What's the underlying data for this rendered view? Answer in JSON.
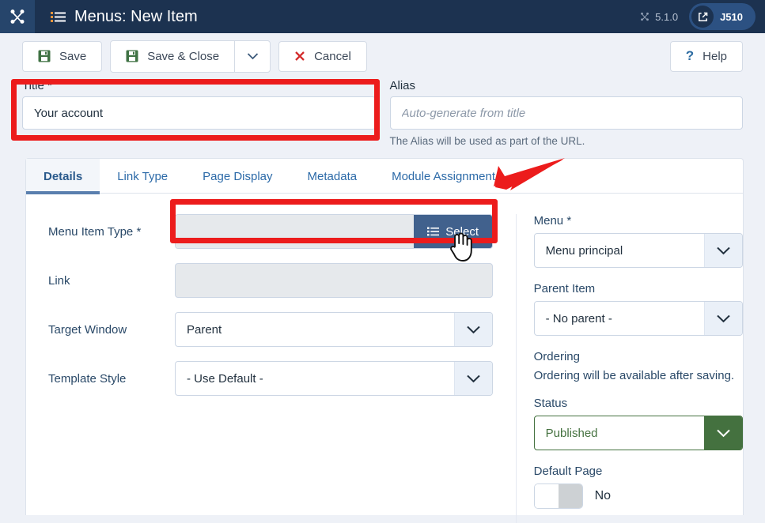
{
  "header": {
    "brand_icon": "joomla-logo-icon",
    "menu_icon": "list-icon",
    "title": "Menus: New Item",
    "version": "5.1.0",
    "version_icon": "joomla-mark-icon",
    "site_badge": "J510",
    "site_badge_icon": "external-link-icon"
  },
  "toolbar": {
    "save_label": "Save",
    "save_icon": "floppy-disk-icon",
    "save_close_label": "Save & Close",
    "save_close_icon": "floppy-disk-icon",
    "dropdown_icon": "chevron-down-icon",
    "cancel_label": "Cancel",
    "cancel_icon": "close-x-icon",
    "help_label": "Help",
    "help_icon": "question-mark-icon"
  },
  "title_field": {
    "label": "Title *",
    "value": "Your account",
    "placeholder": ""
  },
  "alias_field": {
    "label": "Alias",
    "value": "",
    "placeholder": "Auto-generate from title",
    "note": "The Alias will be used as part of the URL."
  },
  "tabs": [
    {
      "label": "Details",
      "active": true
    },
    {
      "label": "Link Type",
      "active": false
    },
    {
      "label": "Page Display",
      "active": false
    },
    {
      "label": "Metadata",
      "active": false
    },
    {
      "label": "Module Assignment",
      "active": false
    }
  ],
  "details": {
    "menu_item_type": {
      "label": "Menu Item Type *",
      "value": "",
      "button_label": "Select",
      "button_icon": "list-icon"
    },
    "link": {
      "label": "Link",
      "value": ""
    },
    "target_window": {
      "label": "Target Window",
      "value": "Parent"
    },
    "template_style": {
      "label": "Template Style",
      "value": "- Use Default -"
    }
  },
  "sidebar": {
    "menu": {
      "label": "Menu *",
      "value": "Menu principal"
    },
    "parent_item": {
      "label": "Parent Item",
      "value": "- No parent -"
    },
    "ordering": {
      "label": "Ordering",
      "note": "Ordering will be available after saving."
    },
    "status": {
      "label": "Status",
      "value": "Published"
    },
    "default_page": {
      "label": "Default Page",
      "value": "No"
    }
  },
  "annotations": {
    "arrow_name": "red-arrow-annotation",
    "title_box_name": "red-highlight-title",
    "type_box_name": "red-highlight-menu-item-type",
    "cursor_name": "hand-cursor",
    "accent_red": "#ec1c1c",
    "accent_blue": "#41618d",
    "accent_green": "#44713f"
  }
}
